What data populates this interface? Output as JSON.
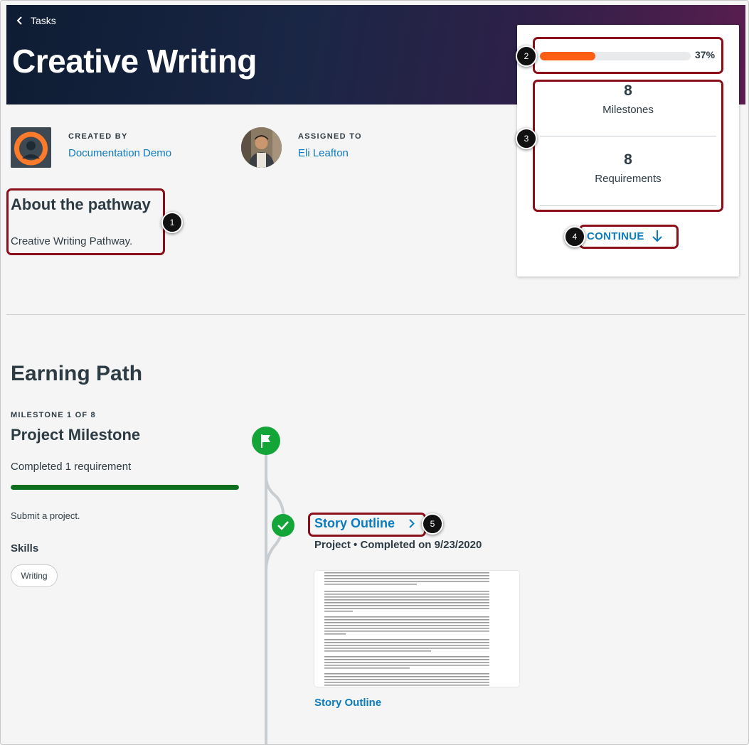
{
  "header": {
    "back_label": "Tasks",
    "title": "Creative Writing"
  },
  "meta": {
    "created_by_label": "CREATED BY",
    "created_by_value": "Documentation Demo",
    "assigned_to_label": "ASSIGNED TO",
    "assigned_to_value": "Eli Leafton"
  },
  "about": {
    "title": "About the pathway",
    "text": "Creative Writing Pathway."
  },
  "sidebar": {
    "progress_percent": 37,
    "progress_label": "37%",
    "milestones_count": "8",
    "milestones_label": "Milestones",
    "requirements_count": "8",
    "requirements_label": "Requirements",
    "continue_label": "CONTINUE"
  },
  "callouts": [
    "1",
    "2",
    "3",
    "4",
    "5"
  ],
  "earning_path": {
    "title": "Earning Path",
    "milestone_label": "MILESTONE 1 OF 8",
    "milestone_title": "Project Milestone",
    "completed_text": "Completed 1 requirement",
    "milestone_progress": 1.0,
    "description": "Submit a project.",
    "skills_title": "Skills",
    "skills": [
      "Writing"
    ],
    "requirement": {
      "title": "Story Outline",
      "meta": "Project • Completed on 9/23/2020",
      "attachment_caption": "Story Outline"
    }
  },
  "colors": {
    "accent_link": "#0b7bc1",
    "progress_orange": "#fc5e13",
    "success_green": "#0b6e1d",
    "check_green": "#13a538",
    "annotation_red": "#8b0e19"
  }
}
